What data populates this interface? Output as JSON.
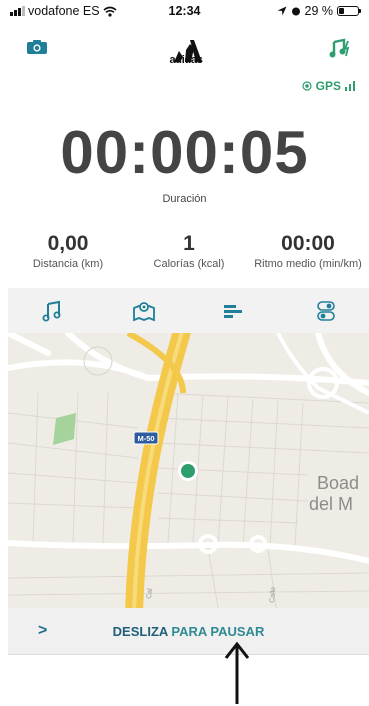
{
  "status_bar": {
    "carrier": "vodafone ES",
    "time": "12:34",
    "battery": "29 %",
    "battery_level": 0.29
  },
  "header": {
    "camera_icon": "camera-icon",
    "brand": "adidas",
    "music_icon": "music-edit-icon",
    "gps_label": "GPS"
  },
  "timer": {
    "value": "00:00:05",
    "label": "Duración"
  },
  "stats": [
    {
      "value": "0,00",
      "label": "Distancia (km)"
    },
    {
      "value": "1",
      "label": "Calorías (kcal)"
    },
    {
      "value": "00:00",
      "label": "Ritmo medio (min/km)"
    }
  ],
  "tabs": [
    {
      "icon": "music-note-icon",
      "active": false
    },
    {
      "icon": "map-icon",
      "active": true
    },
    {
      "icon": "bar-list-icon",
      "active": false
    },
    {
      "icon": "toggles-icon",
      "active": false
    }
  ],
  "map": {
    "highway_label": "M-50",
    "place_label_1": "Boad",
    "place_label_2": "del M",
    "street_1": "Cal",
    "street_2": "Calle"
  },
  "pause": {
    "chevron": ">",
    "label_part1": "DESLIZA ",
    "label_part2": "PARA PAUSAR"
  },
  "colors": {
    "accent_teal": "#2f8a93",
    "gps_green": "#2f9e6c",
    "location_dot": "#2e9e6f",
    "highway": "#f3c84b"
  }
}
